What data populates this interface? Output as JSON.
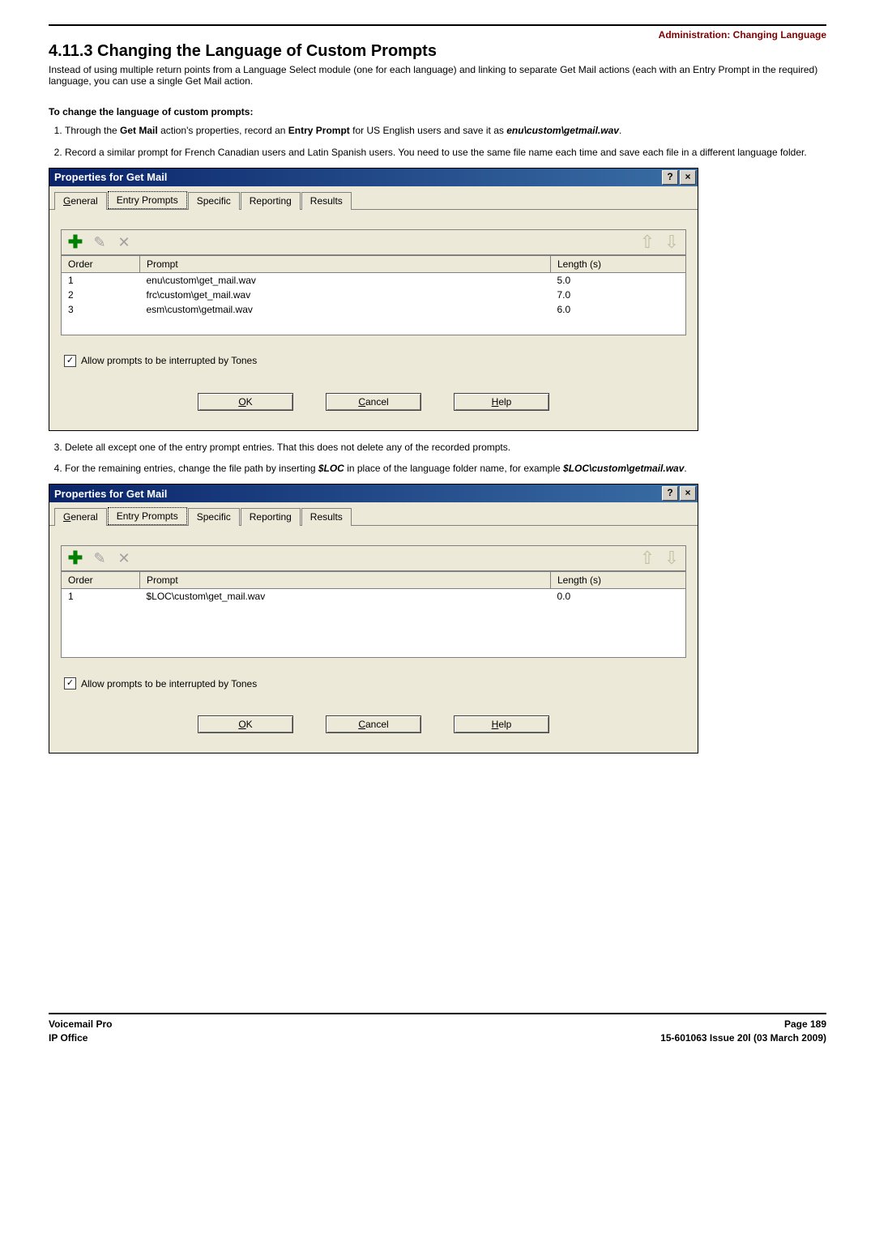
{
  "header": {
    "breadcrumb": "Administration: Changing Language",
    "section_title": "4.11.3 Changing the Language of Custom Prompts",
    "intro": "Instead of using multiple return points from a Language Select module (one for each language) and linking to separate Get Mail actions (each with an Entry Prompt in the required) language, you can use a single Get Mail action.",
    "subhead": "To change the language of custom prompts:"
  },
  "steps": {
    "s1_a": "Through the ",
    "s1_b": "Get Mail",
    "s1_c": " action's properties, record an ",
    "s1_d": "Entry Prompt",
    "s1_e": " for US English users and save it as ",
    "s1_f": "enu\\custom\\getmail.wav",
    "s1_g": ".",
    "s2": "Record a similar prompt for French Canadian users and Latin Spanish users. You need to use the same file name each time and save each file in a different language folder.",
    "s3": "Delete all except one of the entry prompt entries. That this does not delete any of the  recorded prompts.",
    "s4_a": "For the remaining entries, change the file path by inserting ",
    "s4_b": "$LOC",
    "s4_c": " in place of the language folder name, for example ",
    "s4_d": "$LOC\\custom\\getmail.wav",
    "s4_e": "."
  },
  "dialog": {
    "title": "Properties for Get Mail",
    "help_icon": "?",
    "close_icon": "×",
    "tabs": {
      "general": "General",
      "entry": "Entry Prompts",
      "specific": "Specific",
      "reporting": "Reporting",
      "results": "Results"
    },
    "columns": {
      "order": "Order",
      "prompt": "Prompt",
      "length": "Length (s)"
    },
    "checkbox_label": "Allow prompts to be interrupted by Tones",
    "checkbox_mark": "✓",
    "buttons": {
      "ok": "OK",
      "cancel": "Cancel",
      "help": "Help"
    }
  },
  "dialog1": {
    "rows": [
      {
        "order": "1",
        "prompt": "enu\\custom\\get_mail.wav",
        "length": "5.0"
      },
      {
        "order": "2",
        "prompt": "frc\\custom\\get_mail.wav",
        "length": "7.0"
      },
      {
        "order": "3",
        "prompt": "esm\\custom\\getmail.wav",
        "length": "6.0"
      }
    ]
  },
  "dialog2": {
    "rows": [
      {
        "order": "1",
        "prompt": "$LOC\\custom\\get_mail.wav",
        "length": "0.0"
      }
    ]
  },
  "footer": {
    "left1": "Voicemail Pro",
    "left2": "IP Office",
    "right1": "Page 189",
    "right2": "15-601063 Issue 20l (03 March 2009)"
  }
}
